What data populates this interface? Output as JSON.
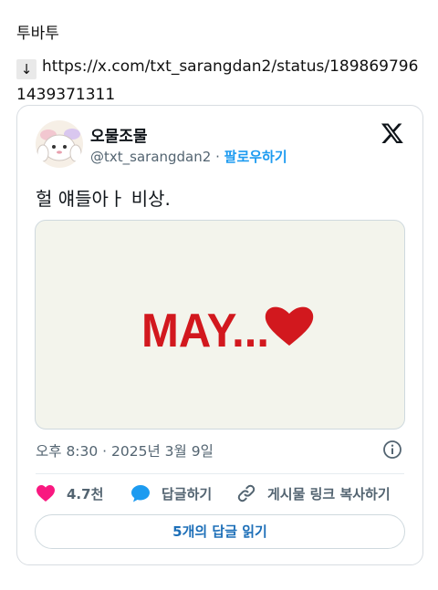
{
  "post": {
    "title": "투바투",
    "arrow": "↓",
    "link": "https://x.com/txt_sarangdan2/status/1898697961439371311"
  },
  "tweet": {
    "display_name": "오물조물",
    "handle": "@txt_sarangdan2",
    "separator": "·",
    "follow_label": "팔로우하기",
    "text": "헐 얘들아ㅏ 비상.",
    "media_text": "MAY...",
    "timestamp": "오후 8:30 · 2025년 3월 9일",
    "like_count": "4.7천",
    "reply_label": "답글하기",
    "copy_link_label": "게시물 링크 복사하기",
    "read_replies_label": "5개의 답글 읽기"
  },
  "colors": {
    "like": "#f91880",
    "reply": "#1d9bf0",
    "follow": "#1d9bf0",
    "media_text": "#d2181e",
    "heart": "#d2181e"
  },
  "icons": [
    "down-arrow-icon",
    "avatar",
    "x-logo-icon",
    "heart-icon",
    "info-icon",
    "like-heart-icon",
    "reply-bubble-icon",
    "link-icon"
  ]
}
